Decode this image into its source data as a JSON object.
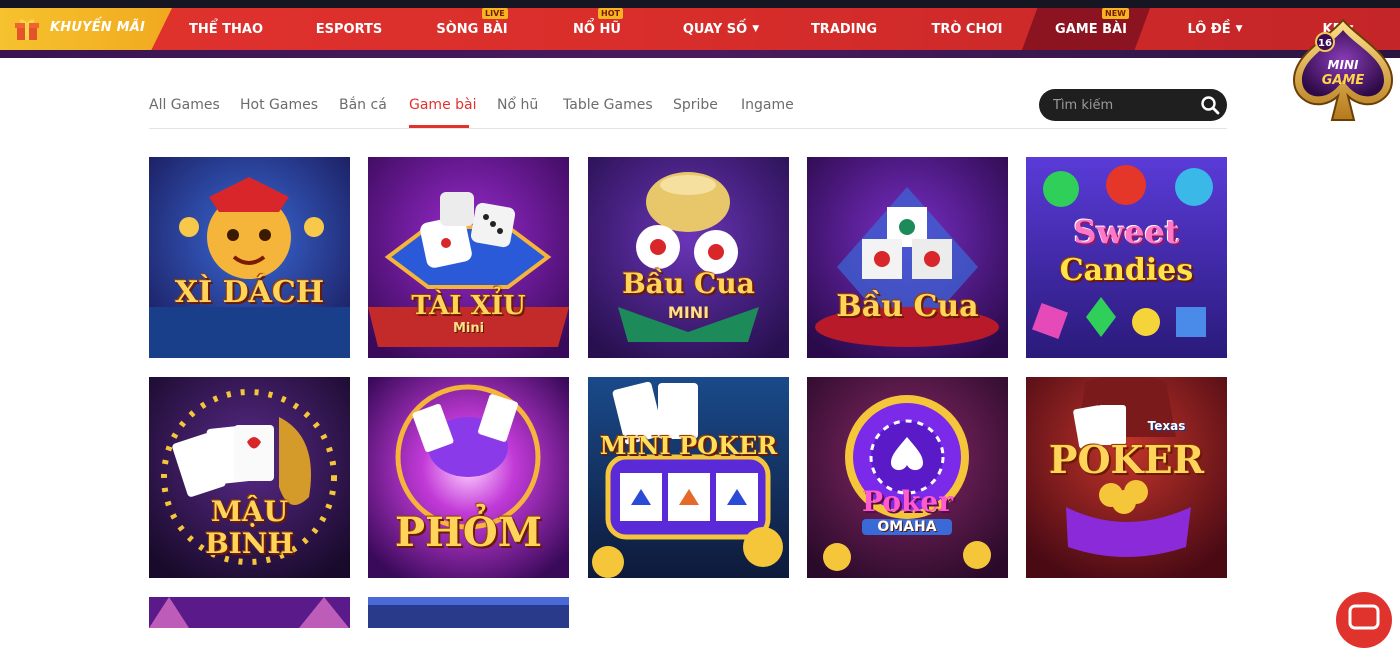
{
  "nav": {
    "promo_label": "KHUYẾN MÃI",
    "items": [
      {
        "label": "THỂ THAO",
        "badge": "",
        "chevron": false
      },
      {
        "label": "ESPORTS",
        "badge": "",
        "chevron": false
      },
      {
        "label": "SÒNG BÀI",
        "badge": "LIVE",
        "chevron": false
      },
      {
        "label": "NỔ HŨ",
        "badge": "HOT",
        "chevron": false
      },
      {
        "label": "QUAY SỐ",
        "badge": "",
        "chevron": true
      },
      {
        "label": "TRADING",
        "badge": "",
        "chevron": false
      },
      {
        "label": "TRÒ CHƠI",
        "badge": "",
        "chevron": false
      },
      {
        "label": "GAME BÀI",
        "badge": "NEW",
        "chevron": false
      },
      {
        "label": "LÔ ĐỀ",
        "badge": "",
        "chevron": true
      },
      {
        "label": "KE",
        "badge": "",
        "chevron": true
      }
    ],
    "active_item": "GAME BÀI",
    "colors": {
      "bar": "#d92e2b",
      "promo": "#f4b327",
      "active": "#8c1420"
    }
  },
  "minigame": {
    "count": "16",
    "line1": "MINI",
    "line2": "GAME"
  },
  "tabs": {
    "items": [
      "All Games",
      "Hot Games",
      "Bắn cá",
      "Game bài",
      "Nổ hũ",
      "Table Games",
      "Spribe",
      "Ingame"
    ],
    "active": "Game bài"
  },
  "search": {
    "placeholder": "Tìm kiếm"
  },
  "games": [
    {
      "title": "XÌ DÁCH",
      "sub": ""
    },
    {
      "title": "TÀI XỈU",
      "sub": "Mini"
    },
    {
      "title": "Bầu Cua",
      "sub": "MINI"
    },
    {
      "title": "Bầu Cua",
      "sub": ""
    },
    {
      "title": "Sweet",
      "sub": "Candies"
    },
    {
      "title": "MẬU",
      "sub": "BINH"
    },
    {
      "title": "PHỎM",
      "sub": ""
    },
    {
      "title": "MINI POKER",
      "sub": ""
    },
    {
      "title": "Poker",
      "sub": "OMAHA"
    },
    {
      "title": "POKER",
      "sub": "Texas"
    }
  ],
  "accent": "#e1332e"
}
